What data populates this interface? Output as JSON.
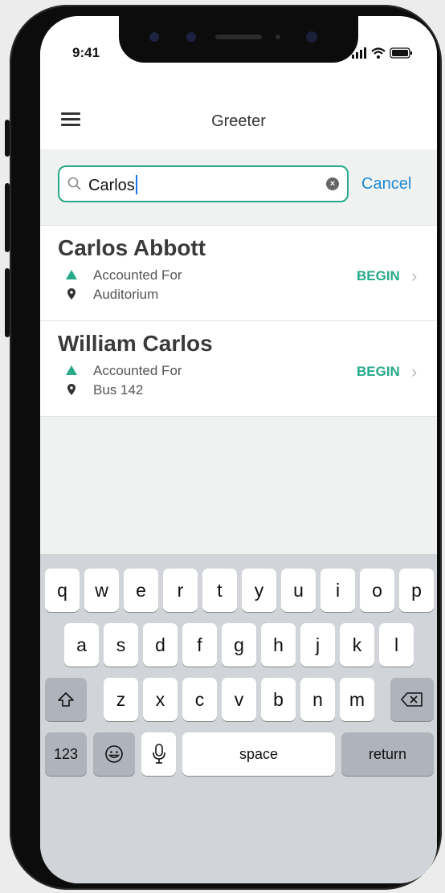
{
  "status_bar": {
    "time": "9:41"
  },
  "header": {
    "title": "Greeter",
    "menu_icon": "hamburger-menu-icon"
  },
  "search": {
    "value": "Carlos",
    "cancel_label": "Cancel"
  },
  "results": [
    {
      "name": "Carlos Abbott",
      "status": "Accounted For",
      "location": "Auditorium",
      "action": "BEGIN"
    },
    {
      "name": "William Carlos",
      "status": "Accounted For",
      "location": "Bus 142",
      "action": "BEGIN"
    }
  ],
  "keyboard": {
    "row1": [
      "q",
      "w",
      "e",
      "r",
      "t",
      "y",
      "u",
      "i",
      "o",
      "p"
    ],
    "row2": [
      "a",
      "s",
      "d",
      "f",
      "g",
      "h",
      "j",
      "k",
      "l"
    ],
    "row3": [
      "z",
      "x",
      "c",
      "v",
      "b",
      "n",
      "m"
    ],
    "numbers_label": "123",
    "space_label": "space",
    "return_label": "return"
  },
  "colors": {
    "accent": "#27a98a",
    "link": "#1b8ad3"
  }
}
